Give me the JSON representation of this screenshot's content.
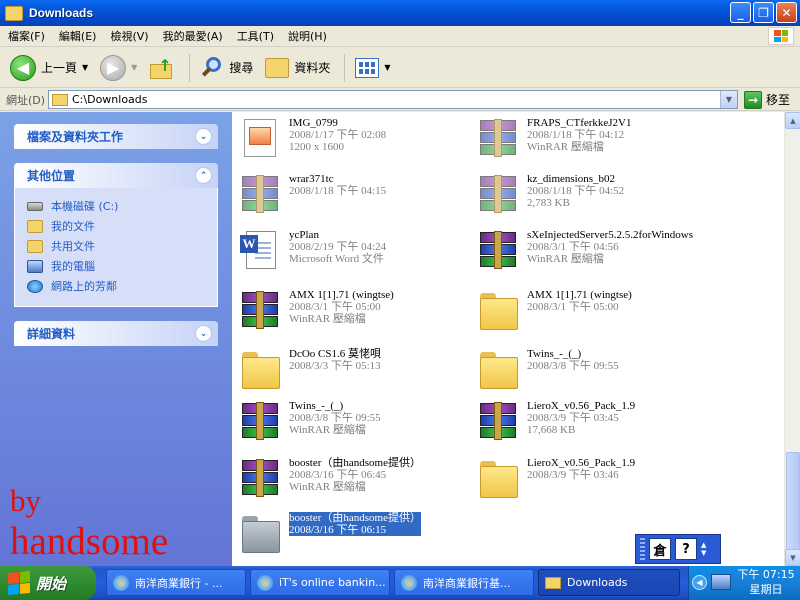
{
  "window": {
    "title": "Downloads",
    "buttons": {
      "minimize": "_",
      "maximize": "❐",
      "close": "✕"
    }
  },
  "menu": [
    {
      "label": "檔案(F)"
    },
    {
      "label": "編輯(E)"
    },
    {
      "label": "檢視(V)"
    },
    {
      "label": "我的最愛(A)"
    },
    {
      "label": "工具(T)"
    },
    {
      "label": "說明(H)"
    }
  ],
  "toolbar": {
    "back_label": "上一頁",
    "search_label": "搜尋",
    "folders_label": "資料夾"
  },
  "address": {
    "label": "網址(D)",
    "value": "C:\\Downloads",
    "go_label": "移至"
  },
  "sidebar": {
    "panels": [
      {
        "title": "檔案及資料夾工作",
        "toggle": "«"
      },
      {
        "title": "其他位置",
        "toggle": "»",
        "items": [
          {
            "label": "本機磁碟 (C:)",
            "icon": "drive-icon"
          },
          {
            "label": "我的文件",
            "icon": "my-documents-icon"
          },
          {
            "label": "共用文件",
            "icon": "shared-documents-icon"
          },
          {
            "label": "我的電腦",
            "icon": "my-computer-icon"
          },
          {
            "label": "網路上的芳鄰",
            "icon": "network-places-icon"
          }
        ]
      },
      {
        "title": "詳細資料",
        "toggle": "«"
      }
    ]
  },
  "files": [
    {
      "name": "IMG_0799",
      "line1": "2008/1/17 下午 02:08",
      "line2": "1200 x 1600",
      "type": "image"
    },
    {
      "name": "FRAPS_CTferkkeJ2V1",
      "line1": "2008/1/18 下午 04:12",
      "line2": "WinRAR 壓縮檔",
      "type": "rar-faded"
    },
    {
      "name": "wrar371tc",
      "line1": "2008/1/18 下午 04:15",
      "line2": "",
      "type": "rar-faded"
    },
    {
      "name": "kz_dimensions_b02",
      "line1": "2008/1/18 下午 04:52",
      "line2": "2,783 KB",
      "type": "rar-faded"
    },
    {
      "name": "ycPlan",
      "line1": "2008/2/19 下午 04:24",
      "line2": "Microsoft Word 文件",
      "type": "word"
    },
    {
      "name": "sXeInjectedServer5.2.5.2forWindows",
      "line1": "2008/3/1 下午 04:56",
      "line2": "WinRAR 壓縮檔",
      "type": "rar"
    },
    {
      "name": "AMX 1[1].71 (wingtse)",
      "line1": "2008/3/1 下午 05:00",
      "line2": "WinRAR 壓縮檔",
      "type": "rar"
    },
    {
      "name": "AMX 1[1].71 (wingtse)",
      "line1": "2008/3/1 下午 05:00",
      "line2": "",
      "type": "folder"
    },
    {
      "name": "DcOo CS1.6 莫恅唄",
      "line1": "2008/3/3 下午 05:13",
      "line2": "",
      "type": "folder"
    },
    {
      "name": "Twins_-_(_)",
      "line1": "2008/3/8 下午 09:55",
      "line2": "",
      "type": "folder"
    },
    {
      "name": "Twins_-_(_)",
      "line1": "2008/3/8 下午 09:55",
      "line2": "WinRAR 壓縮檔",
      "type": "rar"
    },
    {
      "name": "LieroX_v0.56_Pack_1.9",
      "line1": "2008/3/9 下午 03:45",
      "line2": "17,668 KB",
      "type": "rar"
    },
    {
      "name": "booster（由handsome提供）",
      "line1": "2008/3/16 下午 06:45",
      "line2": "WinRAR 壓縮檔",
      "type": "rar"
    },
    {
      "name": "LieroX_v0.56_Pack_1.9",
      "line1": "2008/3/9 下午 03:46",
      "line2": "",
      "type": "folder"
    },
    {
      "name": "booster（由handsome提供）",
      "line1": "2008/3/16 下午 06:15",
      "line2": "",
      "type": "folder-gray",
      "selected": true
    }
  ],
  "watermark": {
    "line1": "by",
    "line2": "handsome"
  },
  "ime": {
    "btn1": "倉",
    "btn2": "?"
  },
  "taskbar": {
    "start_label": "開始",
    "tasks": [
      {
        "label": "南洋商業銀行 - ...",
        "icon": "ie-icon"
      },
      {
        "label": "iT's online bankin...",
        "icon": "ie-icon"
      },
      {
        "label": "南洋商業銀行基...",
        "icon": "ie-icon"
      },
      {
        "label": "Downloads",
        "icon": "folder-icon",
        "active": true
      }
    ],
    "clock_time": "下午 07:15",
    "clock_day": "星期日"
  }
}
